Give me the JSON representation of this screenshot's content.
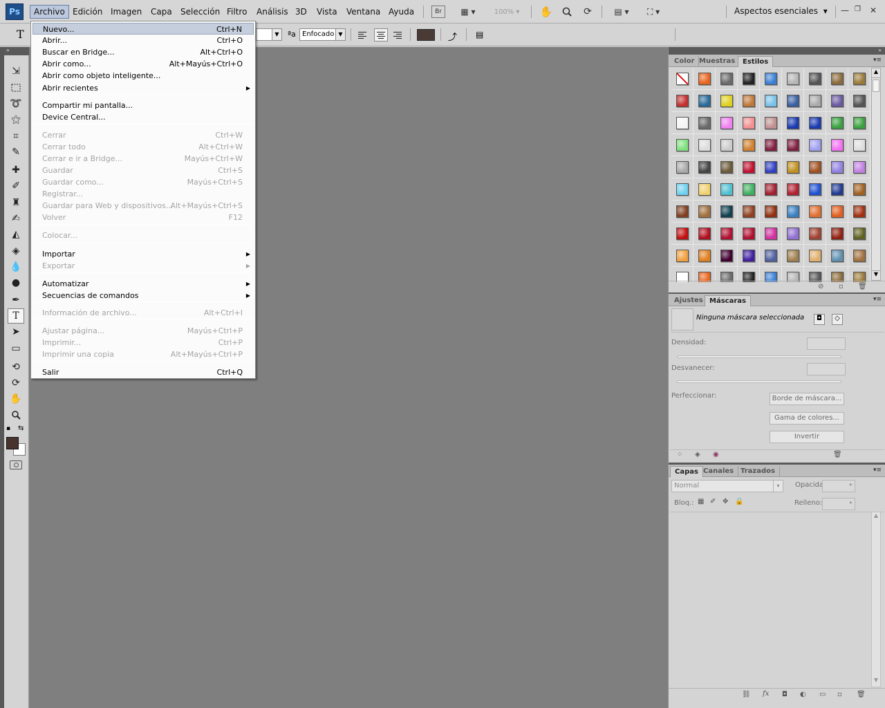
{
  "menubar": {
    "logo": "Ps",
    "items": [
      "Archivo",
      "Edición",
      "Imagen",
      "Capa",
      "Selección",
      "Filtro",
      "Análisis",
      "3D",
      "Vista",
      "Ventana",
      "Ayuda"
    ],
    "bridge_label": "Br",
    "zoom": "100%",
    "workspace": "Aspectos esenciales",
    "icons": [
      "bridge-icon",
      "screen-mode-icon",
      "hand-icon",
      "zoom-icon",
      "rotate-view-icon",
      "arrange-documents-icon",
      "screen-mode-icon"
    ]
  },
  "options": {
    "tool_glyph": "T",
    "antialias_glyph": "ªa",
    "antialias": "Enfocado",
    "text_color": "#4a3a36"
  },
  "file_menu": {
    "items": [
      {
        "label": "Nuevo...",
        "shortcut": "Ctrl+N",
        "enabled": true,
        "highlighted": true
      },
      {
        "label": "Abrir...",
        "shortcut": "Ctrl+O",
        "enabled": true
      },
      {
        "label": "Buscar en Bridge...",
        "shortcut": "Alt+Ctrl+O",
        "enabled": true
      },
      {
        "label": "Abrir como...",
        "shortcut": "Alt+Mayús+Ctrl+O",
        "enabled": true
      },
      {
        "label": "Abrir como objeto inteligente...",
        "shortcut": "",
        "enabled": true
      },
      {
        "label": "Abrir recientes",
        "shortcut": "",
        "enabled": true,
        "submenu": true
      },
      {
        "label": "Compartir mi pantalla...",
        "shortcut": "",
        "enabled": true
      },
      {
        "label": "Device Central...",
        "shortcut": "",
        "enabled": true
      },
      {
        "label": "Cerrar",
        "shortcut": "Ctrl+W",
        "enabled": false
      },
      {
        "label": "Cerrar todo",
        "shortcut": "Alt+Ctrl+W",
        "enabled": false
      },
      {
        "label": "Cerrar e ir a Bridge...",
        "shortcut": "Mayús+Ctrl+W",
        "enabled": false
      },
      {
        "label": "Guardar",
        "shortcut": "Ctrl+S",
        "enabled": false
      },
      {
        "label": "Guardar como...",
        "shortcut": "Mayús+Ctrl+S",
        "enabled": false
      },
      {
        "label": "Registrar...",
        "shortcut": "",
        "enabled": false
      },
      {
        "label": "Guardar para Web y dispositivos...",
        "shortcut": "Alt+Mayús+Ctrl+S",
        "enabled": false
      },
      {
        "label": "Volver",
        "shortcut": "F12",
        "enabled": false
      },
      {
        "label": "Colocar...",
        "shortcut": "",
        "enabled": false
      },
      {
        "label": "Importar",
        "shortcut": "",
        "enabled": true,
        "submenu": true
      },
      {
        "label": "Exportar",
        "shortcut": "",
        "enabled": false,
        "submenu": true
      },
      {
        "label": "Automatizar",
        "shortcut": "",
        "enabled": true,
        "submenu": true
      },
      {
        "label": "Secuencias de comandos",
        "shortcut": "",
        "enabled": true,
        "submenu": true
      },
      {
        "label": "Información de archivo...",
        "shortcut": "Alt+Ctrl+I",
        "enabled": false
      },
      {
        "label": "Ajustar página...",
        "shortcut": "Mayús+Ctrl+P",
        "enabled": false
      },
      {
        "label": "Imprimir...",
        "shortcut": "Ctrl+P",
        "enabled": false
      },
      {
        "label": "Imprimir una copia",
        "shortcut": "Alt+Mayús+Ctrl+P",
        "enabled": false
      },
      {
        "label": "Salir",
        "shortcut": "Ctrl+Q",
        "enabled": true
      }
    ]
  },
  "styles_panel": {
    "tabs": [
      "Color",
      "Muestras",
      "Estilos"
    ],
    "active_tab": "Estilos"
  },
  "masks_panel": {
    "tabs": [
      "Ajustes",
      "Máscaras"
    ],
    "active_tab": "Máscaras",
    "status": "Ninguna máscara seleccionada",
    "density_label": "Densidad:",
    "feather_label": "Desvanecer:",
    "refine_label": "Perfeccionar:",
    "buttons": [
      "Borde de máscara...",
      "Gama de colores...",
      "Invertir"
    ]
  },
  "layers_panel": {
    "tabs": [
      "Capas",
      "Canales",
      "Trazados"
    ],
    "active_tab": "Capas",
    "blend_mode": "Normal",
    "opacity_label": "Opacidad:",
    "lock_label": "Bloq.:",
    "fill_label": "Relleno:",
    "footer_glyph_fx": "fx"
  },
  "tools": [
    "move-tool-icon",
    "marquee-tool-icon",
    "lasso-tool-icon",
    "magic-wand-tool-icon",
    "crop-tool-icon",
    "eyedropper-tool-icon",
    "healing-brush-tool-icon",
    "brush-tool-icon",
    "clone-stamp-tool-icon",
    "history-brush-tool-icon",
    "eraser-tool-icon",
    "paint-bucket-tool-icon",
    "blur-tool-icon",
    "dodge-tool-icon",
    "pen-tool-icon",
    "type-tool-icon",
    "path-selection-tool-icon",
    "shape-tool-icon",
    "3d-rotate-tool-icon",
    "3d-orbit-tool-icon",
    "hand-tool-icon",
    "zoom-tool-icon"
  ],
  "colors": {
    "foreground": "#47342f",
    "background": "#ffffff",
    "canvas": "#7f7f7f"
  }
}
